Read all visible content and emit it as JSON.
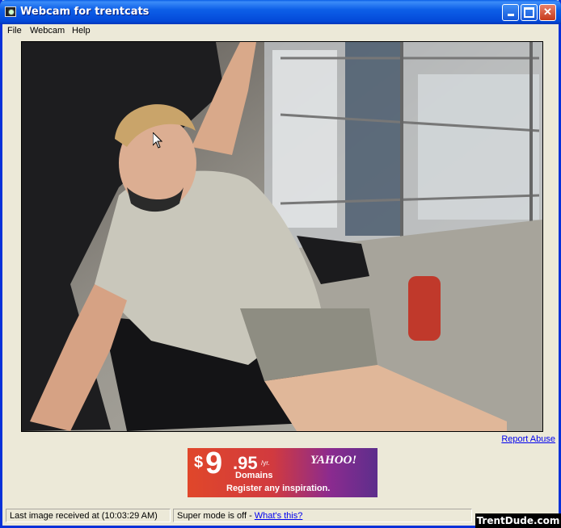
{
  "window": {
    "title": "Webcam for trentcats",
    "icon": "webcam-app-icon"
  },
  "menu": {
    "items": [
      {
        "label": "File"
      },
      {
        "label": "Webcam"
      },
      {
        "label": "Help"
      }
    ]
  },
  "viewer": {
    "image_description_icon": "webcam-feed"
  },
  "links": {
    "report_abuse": "Report Abuse"
  },
  "ad": {
    "price_dollar": "$",
    "price_main": "9",
    "price_cents": ".95",
    "price_period": "/yr.",
    "product": "Domains",
    "tagline": "Register any inspiration.",
    "brand": "YAHOO!"
  },
  "status": {
    "last_image": "Last image received at (10:03:29 AM)",
    "super_mode": "Super mode is off - ",
    "whats_this": "What's this?"
  },
  "watermark": "TrentDude.com",
  "colors": {
    "title_bar": "#0a5ee6",
    "window_bg": "#ece9d8",
    "link": "#0000ee"
  }
}
